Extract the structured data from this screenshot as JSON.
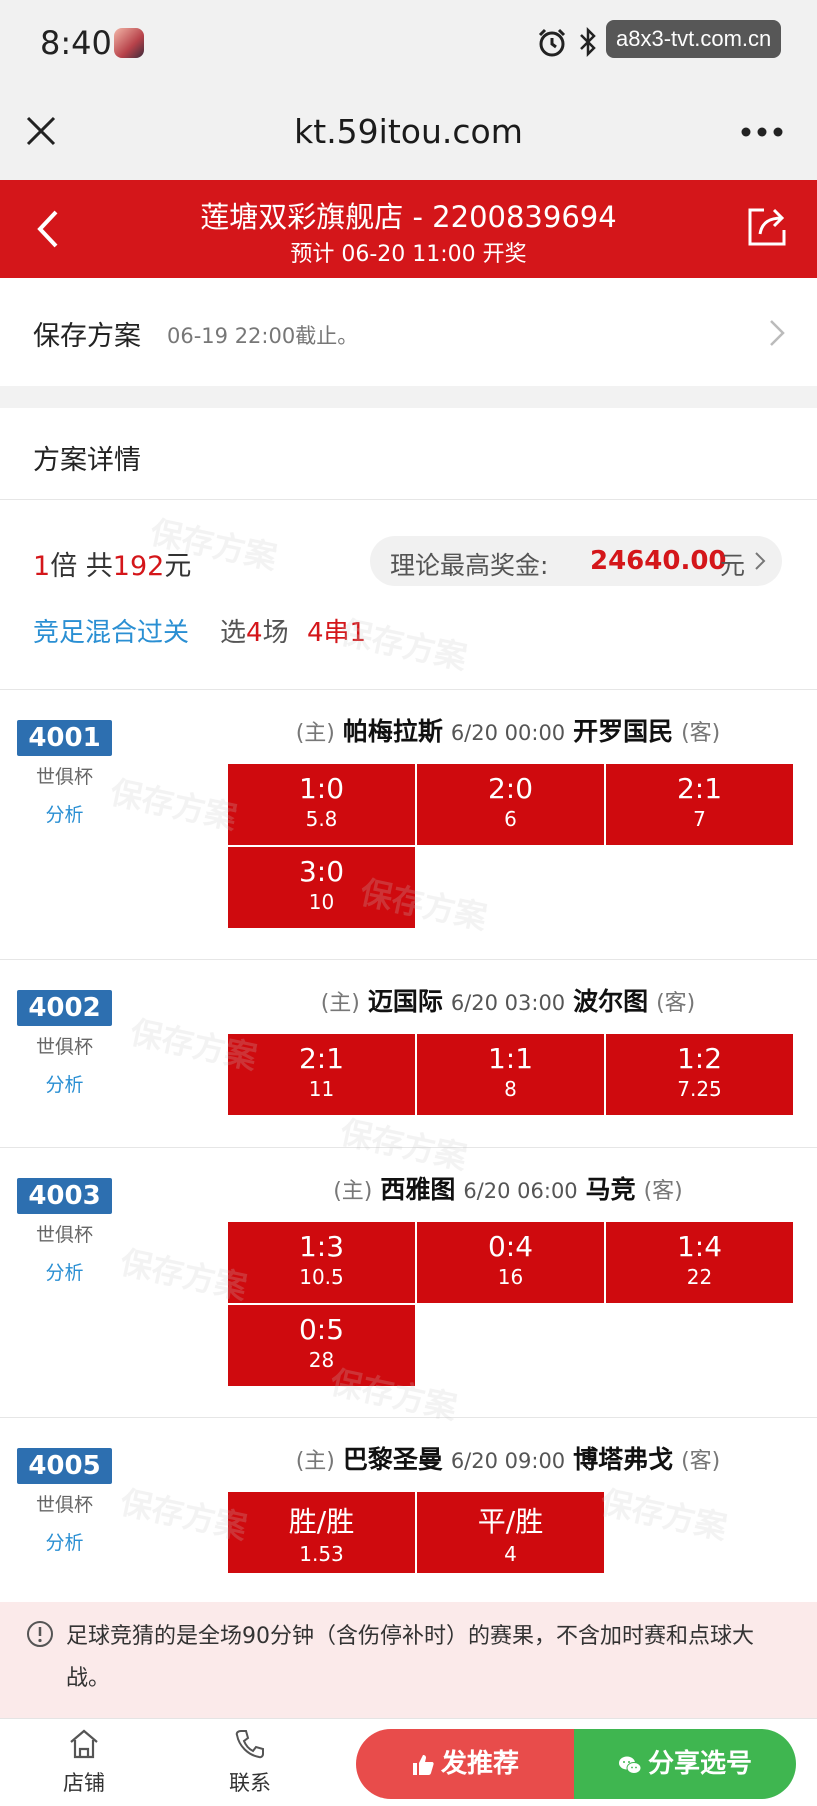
{
  "status_bar": {
    "time": "8:40",
    "watermark": "a8x3-tvt.com.cn"
  },
  "browser": {
    "url": "kt.59itou.com"
  },
  "header": {
    "title": "莲塘双彩旗舰店 - 2200839694",
    "subtitle": "预计 06-20 11:00 开奖"
  },
  "save_plan": {
    "label": "保存方案",
    "deadline": "06-19 22:00截止。"
  },
  "plan_detail": {
    "label": "方案详情"
  },
  "summary": {
    "multiplier_num": "1",
    "multiplier_unit": "倍 共",
    "total_num": "192",
    "total_unit": "元",
    "prize_label": "理论最高奖金:",
    "prize_amount": "24640.00",
    "prize_unit": "元",
    "play_type": "竞足混合过关",
    "pick_prefix": "选",
    "pick_num": "4",
    "pick_suffix": "场",
    "combo": "4串1"
  },
  "watermark_text": "保存方案",
  "matches": [
    {
      "no": "4001",
      "league": "世俱杯",
      "analysis": "分析",
      "home_tag": "(主)",
      "home": "帕梅拉斯",
      "kickoff": "6/20 00:00",
      "away": "开罗国民",
      "away_tag": "(客)",
      "odds": [
        {
          "result": "1:0",
          "value": "5.8"
        },
        {
          "result": "2:0",
          "value": "6"
        },
        {
          "result": "2:1",
          "value": "7"
        },
        {
          "result": "3:0",
          "value": "10"
        }
      ]
    },
    {
      "no": "4002",
      "league": "世俱杯",
      "analysis": "分析",
      "home_tag": "(主)",
      "home": "迈国际",
      "kickoff": "6/20 03:00",
      "away": "波尔图",
      "away_tag": "(客)",
      "odds": [
        {
          "result": "2:1",
          "value": "11"
        },
        {
          "result": "1:1",
          "value": "8"
        },
        {
          "result": "1:2",
          "value": "7.25"
        }
      ]
    },
    {
      "no": "4003",
      "league": "世俱杯",
      "analysis": "分析",
      "home_tag": "(主)",
      "home": "西雅图",
      "kickoff": "6/20 06:00",
      "away": "马竞",
      "away_tag": "(客)",
      "odds": [
        {
          "result": "1:3",
          "value": "10.5"
        },
        {
          "result": "0:4",
          "value": "16"
        },
        {
          "result": "1:4",
          "value": "22"
        },
        {
          "result": "0:5",
          "value": "28"
        }
      ]
    },
    {
      "no": "4005",
      "league": "世俱杯",
      "analysis": "分析",
      "home_tag": "(主)",
      "home": "巴黎圣曼",
      "kickoff": "6/20 09:00",
      "away": "博塔弗戈",
      "away_tag": "(客)",
      "odds": [
        {
          "result": "胜/胜",
          "value": "1.53"
        },
        {
          "result": "平/胜",
          "value": "4"
        }
      ]
    }
  ],
  "notice": {
    "text": "足球竞猜的是全场90分钟（含伤停补时）的赛果，不含加时赛和点球大战。"
  },
  "bottom_nav": {
    "store": "店铺",
    "contact": "联系",
    "recommend": "发推荐",
    "share": "分享选号"
  },
  "colors": {
    "brand_red": "#d4161a",
    "odds_red": "#cf0a0e",
    "link_blue": "#2a8fd3",
    "match_no_blue": "#2d6fb0",
    "share_green": "#3fb650"
  }
}
